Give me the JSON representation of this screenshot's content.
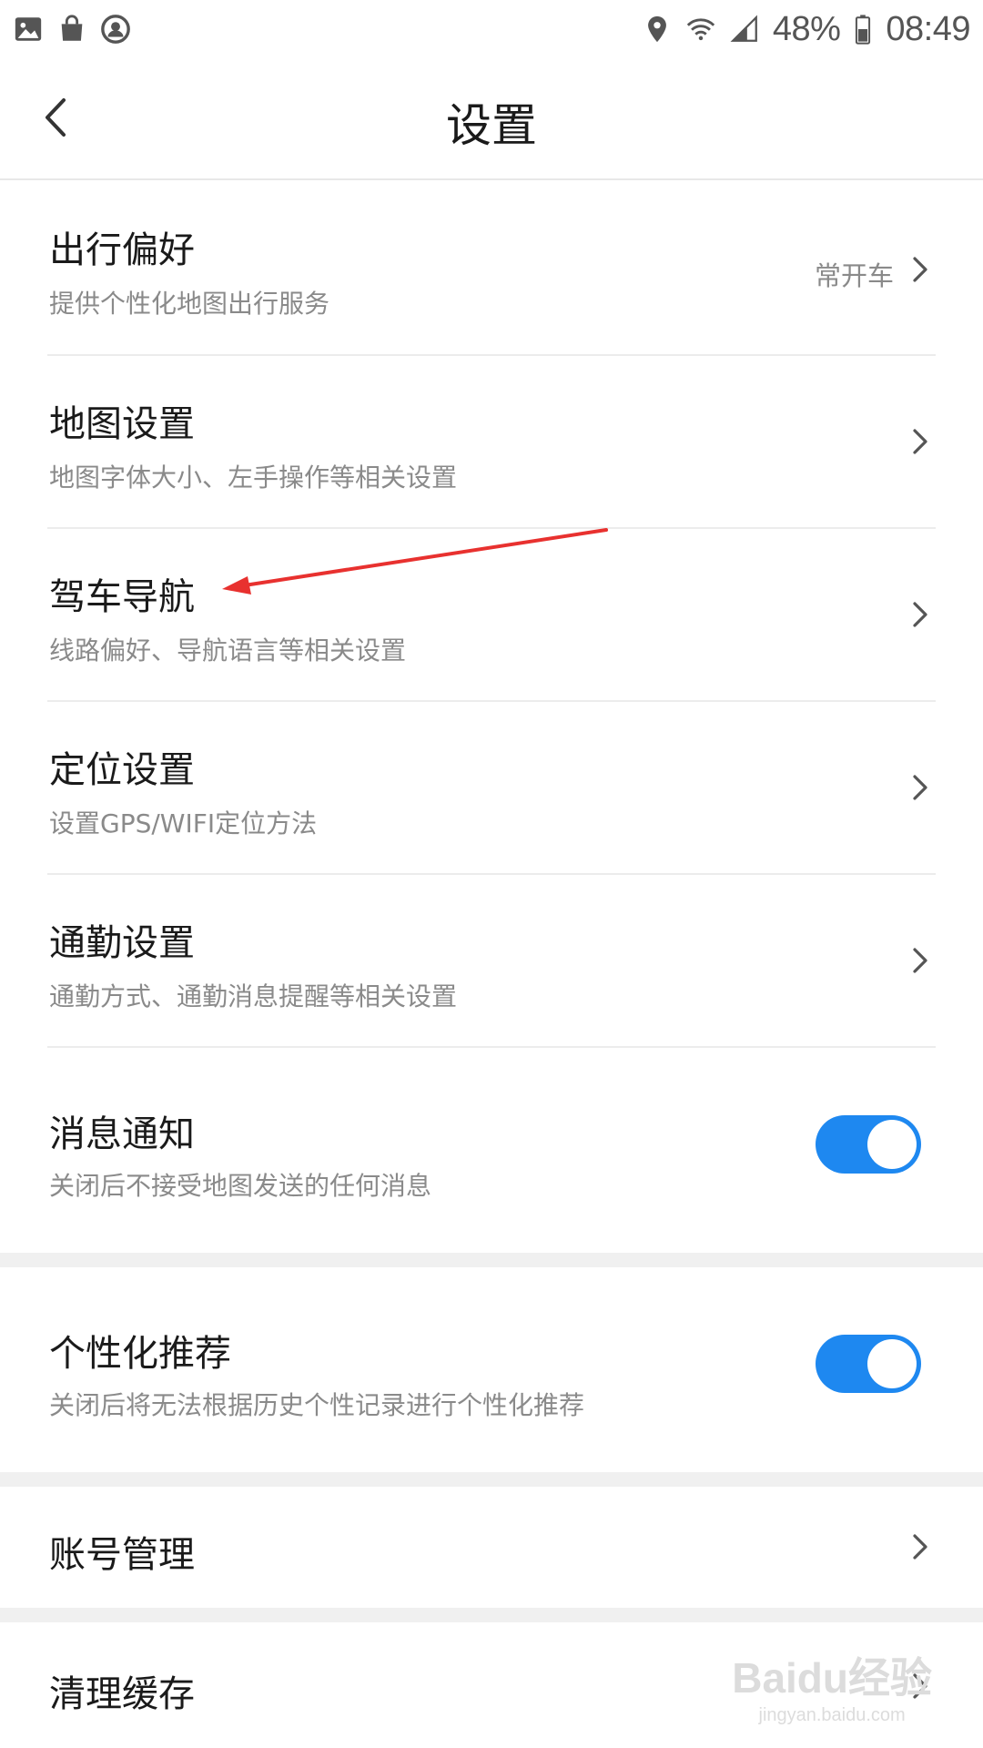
{
  "status_bar": {
    "left_icons": [
      "gallery-icon",
      "shopping-bag-icon",
      "account-icon"
    ],
    "right_icons": [
      "location-icon",
      "wifi-icon",
      "signal-icon",
      "battery-icon"
    ],
    "battery": "48%",
    "time": "08:49"
  },
  "header": {
    "title": "设置",
    "back_icon": "chevron-left-icon"
  },
  "settings": [
    {
      "title": "出行偏好",
      "subtitle": "提供个性化地图出行服务",
      "value": "常开车",
      "control": "chevron"
    },
    {
      "title": "地图设置",
      "subtitle": "地图字体大小、左手操作等相关设置",
      "control": "chevron"
    },
    {
      "title": "驾车导航",
      "subtitle": "线路偏好、导航语言等相关设置",
      "control": "chevron"
    },
    {
      "title": "定位设置",
      "subtitle": "设置GPS/WIFI定位方法",
      "control": "chevron"
    },
    {
      "title": "通勤设置",
      "subtitle": "通勤方式、通勤消息提醒等相关设置",
      "control": "chevron"
    },
    {
      "title": "消息通知",
      "subtitle": "关闭后不接受地图发送的任何消息",
      "control": "toggle",
      "on": true
    },
    {
      "title": "个性化推荐",
      "subtitle": "关闭后将无法根据历史个性记录进行个性化推荐",
      "control": "toggle",
      "on": true
    },
    {
      "title": "账号管理",
      "control": "chevron"
    },
    {
      "title": "清理缓存",
      "control": "chevron"
    }
  ],
  "colors": {
    "toggle_on": "#1e88f0",
    "annotation_arrow": "#e8312f",
    "section_gap": "#f0f0f0"
  },
  "watermark": {
    "main": "Baidu经验",
    "sub": "jingyan.baidu.com"
  }
}
